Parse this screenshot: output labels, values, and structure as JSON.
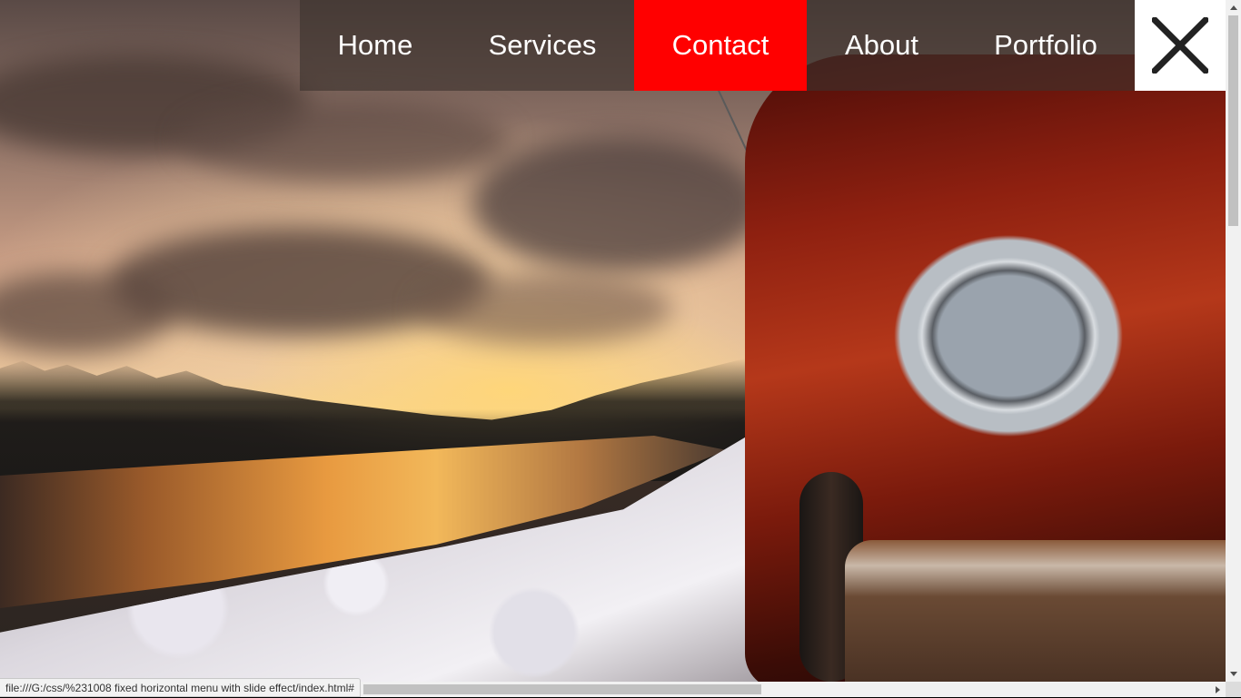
{
  "nav": {
    "items": [
      {
        "label": "Home",
        "active": false
      },
      {
        "label": "Services",
        "active": false
      },
      {
        "label": "Contact",
        "active": true
      },
      {
        "label": "About",
        "active": false
      },
      {
        "label": "Portfolio",
        "active": false
      }
    ],
    "active_color": "#ff0000",
    "close_icon": "close-icon"
  },
  "status_bar": {
    "url": "file:///G:/css/%231008 fixed horizontal menu with slide effect/index.html#"
  },
  "colors": {
    "menu_background": "rgba(60,50,45,0.62)",
    "menu_text": "#ffffff",
    "close_background": "#ffffff",
    "close_icon": "#222222"
  }
}
